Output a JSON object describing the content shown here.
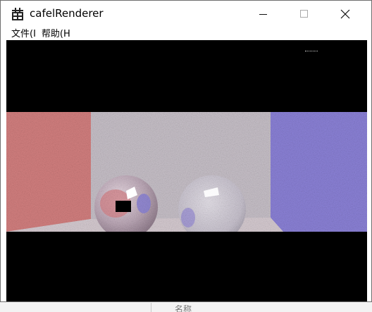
{
  "window": {
    "title": "cafelRenderer",
    "icon": "app-icon"
  },
  "menu": {
    "items": [
      {
        "label": "文件(I"
      },
      {
        "label": "帮助(H"
      }
    ]
  },
  "taskbar_fragment": {
    "label": "名称"
  },
  "colors": {
    "client_bg": "#000000",
    "wall_left": "#d98282",
    "wall_right": "#8a82d6",
    "wall_back": "#c9c4cc"
  }
}
